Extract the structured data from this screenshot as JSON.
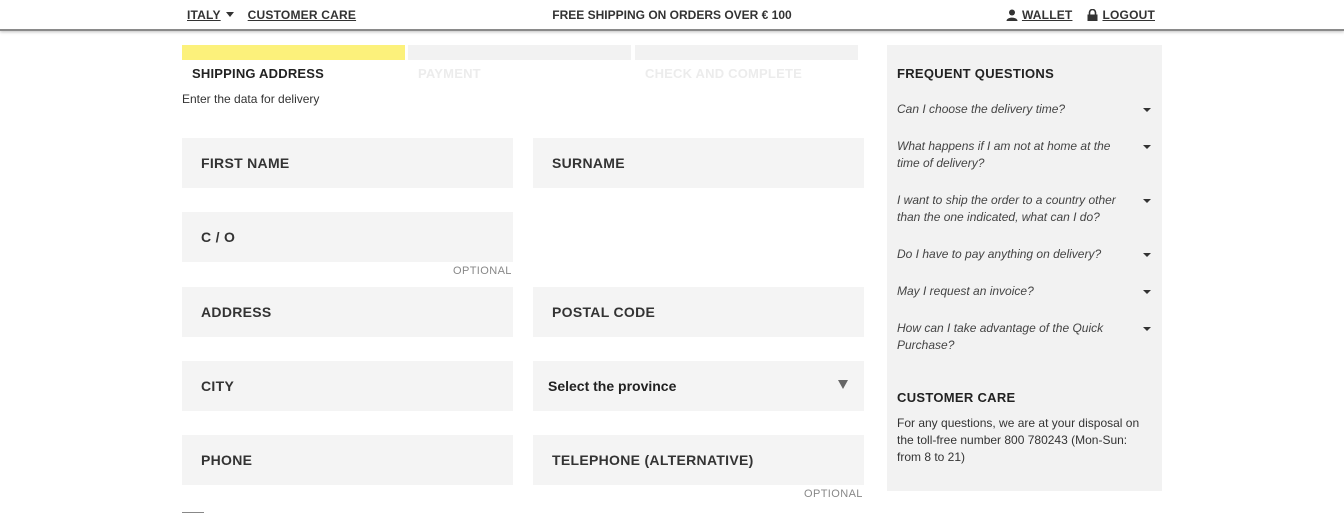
{
  "topbar": {
    "country": "ITALY",
    "customer_care": "CUSTOMER CARE",
    "promo": "FREE SHIPPING ON ORDERS OVER € 100",
    "wallet": "WALLET",
    "logout": "LOGOUT"
  },
  "steps": [
    {
      "label": "SHIPPING ADDRESS",
      "active": true
    },
    {
      "label": "PAYMENT",
      "active": false
    },
    {
      "label": "CHECK AND COMPLETE",
      "active": false
    }
  ],
  "subtitle": "Enter the data for delivery",
  "form": {
    "first_name": "FIRST NAME",
    "surname": "SURNAME",
    "care_of": "C / O",
    "care_of_optional": "OPTIONAL",
    "address": "ADDRESS",
    "postal_code": "POSTAL CODE",
    "city": "CITY",
    "province": "Select the province",
    "phone": "PHONE",
    "phone_alt": "TELEPHONE (ALTERNATIVE)",
    "phone_alt_optional": "OPTIONAL"
  },
  "faq": {
    "title": "FREQUENT QUESTIONS",
    "questions": [
      "Can I choose the delivery time?",
      "What happens if I am not at home at the time of delivery?",
      "I want to ship the order to a country other than the one indicated, what can I do?",
      "Do I have to pay anything on delivery?",
      "May I request an invoice?",
      "How can I take advantage of the Quick Purchase?"
    ]
  },
  "customer_care": {
    "title": "CUSTOMER CARE",
    "text": "For any questions, we are at your disposal on the toll-free number 800 780243 (Mon-Sun: from 8 to 21)"
  },
  "colors": {
    "accent_yellow": "#fcf17b",
    "field_bg": "#f4f4f4",
    "sidebar_bg": "#f2f2f2"
  }
}
